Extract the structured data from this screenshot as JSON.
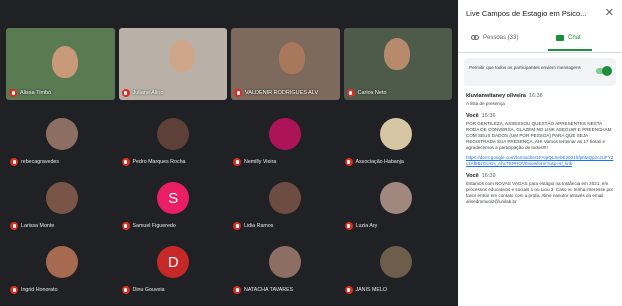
{
  "meeting": {
    "video_tiles": [
      {
        "name": "Alissa Timbó",
        "bg": "#5a7a52",
        "skin": "#c99a7a"
      },
      {
        "name": "Juliane Alino",
        "bg": "#b9b1a8",
        "skin": "#d0a68a"
      },
      {
        "name": "VALDENIR RODRIGUES ALV",
        "bg": "#7d6a5c",
        "skin": "#a7785c"
      },
      {
        "name": "Carlos Neto",
        "bg": "#4e5b4a",
        "skin": "#b68a6a"
      }
    ],
    "participants": [
      {
        "name": "rebecagravedes",
        "type": "photo",
        "color": "#8d6e63"
      },
      {
        "name": "Pedro Marques Rocha",
        "type": "photo",
        "color": "#5d4037"
      },
      {
        "name": "Nemilly Vieira",
        "type": "photo",
        "color": "#ad1457"
      },
      {
        "name": "Associação Habanja",
        "type": "photo",
        "color": "#d7c6a3"
      },
      {
        "name": "Larissa Monte",
        "type": "photo",
        "color": "#795548"
      },
      {
        "name": "Samuel Figueredo",
        "type": "letter",
        "letter": "S",
        "color": "#e91e63"
      },
      {
        "name": "Lidia Ramos",
        "type": "photo",
        "color": "#6d4c41"
      },
      {
        "name": "Luzia Ary",
        "type": "photo",
        "color": "#a1887f"
      },
      {
        "name": "Ingrid Honorato",
        "type": "photo",
        "color": "#a56a50"
      },
      {
        "name": "Dinu Gouveia",
        "type": "letter",
        "letter": "D",
        "color": "#c62828"
      },
      {
        "name": "NATACHA TAVARES",
        "type": "photo",
        "color": "#8d6e63"
      },
      {
        "name": "JANIS MELO",
        "type": "photo",
        "color": "#6d5d4b"
      }
    ]
  },
  "panel": {
    "title": "Live Campos de Estagio em Psico...",
    "close_glyph": "✕",
    "tabs": {
      "people": "Pessoas (33)",
      "chat": "Chat"
    },
    "setting_text": "Permitir que todos os participantes enviem mensagens",
    "messages": [
      {
        "sender": "kluvianwitaney oliveira",
        "time": "16:36",
        "text": "A lista de presença"
      },
      {
        "sender": "Você",
        "time": "16:36",
        "text": "POR GENTILEZA, ASSESSOU QUESTÃO APRESENTES NESTA RODA DE CONVERSA, GLAZEM NO LINK ASEGUIR E PREENCHAM COM SEUS DADOS (UM POR PESSOA) PARA QUE SEJA REGISTRADA SUA PRESENÇA, AH! Vamos terminar as 17 horas e agradecemos a participação de todos!!!!",
        "link": "https://docs.google.com/forms/d/e/1FAIpQLSebE2021hfpMaQpzcJUFY2czAfbBzGUGs_AhcTEPHOVEviewform?usp=sf_link"
      },
      {
        "sender": "Você",
        "time": "16:39",
        "text": "Estamos com NOVAS VAGAS para estágio na Instância em 2021, em processos educativos e sociais 1 ou Liou 3. Caso vc tenha interesse por favor entrar em contato com a profa. Aline nanutor através do email alinedmmuniz@unilab.br"
      }
    ]
  }
}
